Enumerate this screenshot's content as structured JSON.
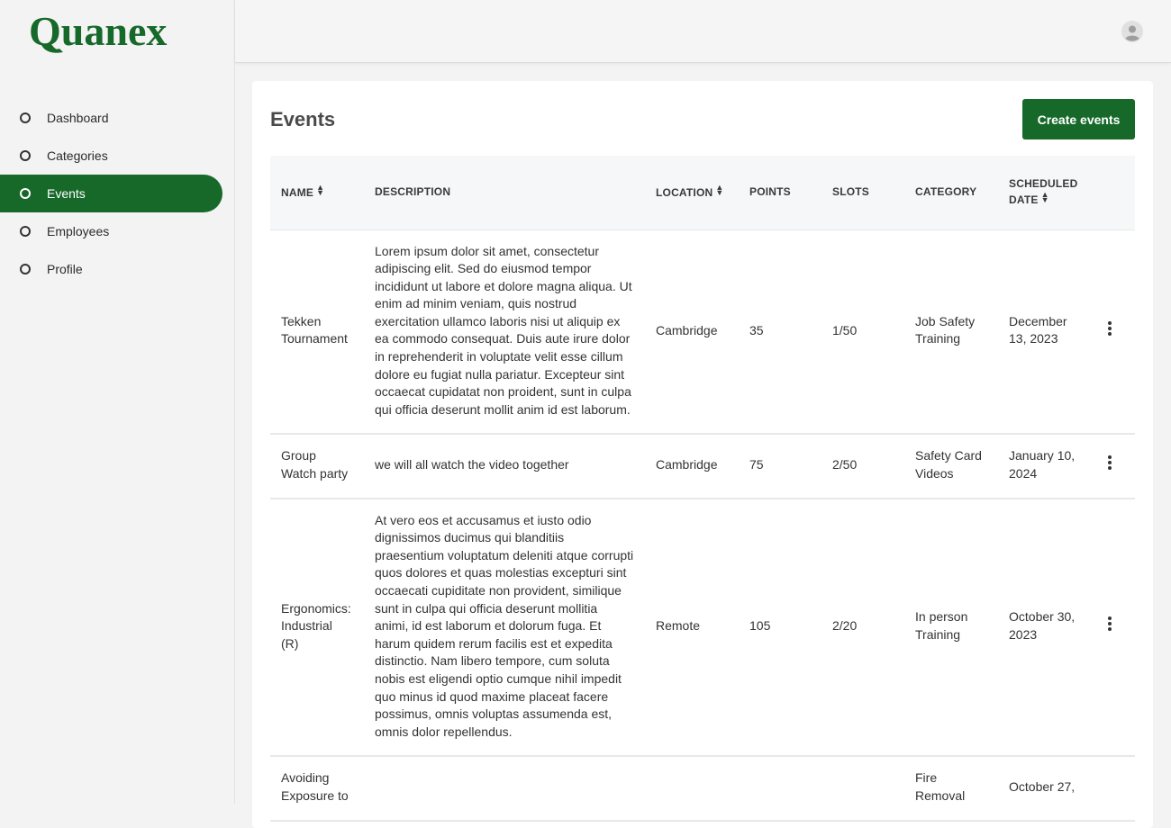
{
  "brand": {
    "logo_text": "Quanex",
    "color": "#17692a"
  },
  "sidebar": {
    "items": [
      {
        "label": "Dashboard",
        "active": false
      },
      {
        "label": "Categories",
        "active": false
      },
      {
        "label": "Events",
        "active": true
      },
      {
        "label": "Employees",
        "active": false
      },
      {
        "label": "Profile",
        "active": false
      }
    ]
  },
  "header": {
    "avatar_icon": "user-avatar-icon"
  },
  "main": {
    "title": "Events",
    "create_label": "Create events",
    "columns": [
      {
        "label": "NAME",
        "sortable": true
      },
      {
        "label": "DESCRIPTION",
        "sortable": false
      },
      {
        "label": "LOCATION",
        "sortable": true
      },
      {
        "label": "POINTS",
        "sortable": false
      },
      {
        "label": "SLOTS",
        "sortable": false
      },
      {
        "label": "CATEGORY",
        "sortable": false
      },
      {
        "label": "SCHEDULED DATE",
        "sortable": true
      }
    ],
    "rows": [
      {
        "name": "Tekken Tournament",
        "description": "Lorem ipsum dolor sit amet, consectetur adipiscing elit. Sed do eiusmod tempor incididunt ut labore et dolore magna aliqua. Ut enim ad minim veniam, quis nostrud exercitation ullamco laboris nisi ut aliquip ex ea commodo consequat. Duis aute irure dolor in reprehenderit in voluptate velit esse cillum dolore eu fugiat nulla pariatur. Excepteur sint occaecat cupidatat non proident, sunt in culpa qui officia deserunt mollit anim id est laborum.",
        "location": "Cambridge",
        "points": "35",
        "slots": "1/50",
        "category": "Job Safety Training",
        "date": "December 13, 2023"
      },
      {
        "name": "Group Watch party",
        "description": "we will all watch the video together",
        "location": "Cambridge",
        "points": "75",
        "slots": "2/50",
        "category": "Safety Card Videos",
        "date": "January 10, 2024"
      },
      {
        "name": "Ergonomics: Industrial (R)",
        "description": "At vero eos et accusamus et iusto odio dignissimos ducimus qui blanditiis praesentium voluptatum deleniti atque corrupti quos dolores et quas molestias excepturi sint occaecati cupiditate non provident, similique sunt in culpa qui officia deserunt mollitia animi, id est laborum et dolorum fuga. Et harum quidem rerum facilis est et expedita distinctio. Nam libero tempore, cum soluta nobis est eligendi optio cumque nihil impedit quo minus id quod maxime placeat facere possimus, omnis voluptas assumenda est, omnis dolor repellendus.",
        "location": "Remote",
        "points": "105",
        "slots": "2/20",
        "category": "In person Training",
        "date": "October 30, 2023"
      },
      {
        "name": "Avoiding Exposure to",
        "description": "",
        "location": "",
        "points": "",
        "slots": "",
        "category": "Fire Removal",
        "date": "October 27,"
      }
    ]
  }
}
